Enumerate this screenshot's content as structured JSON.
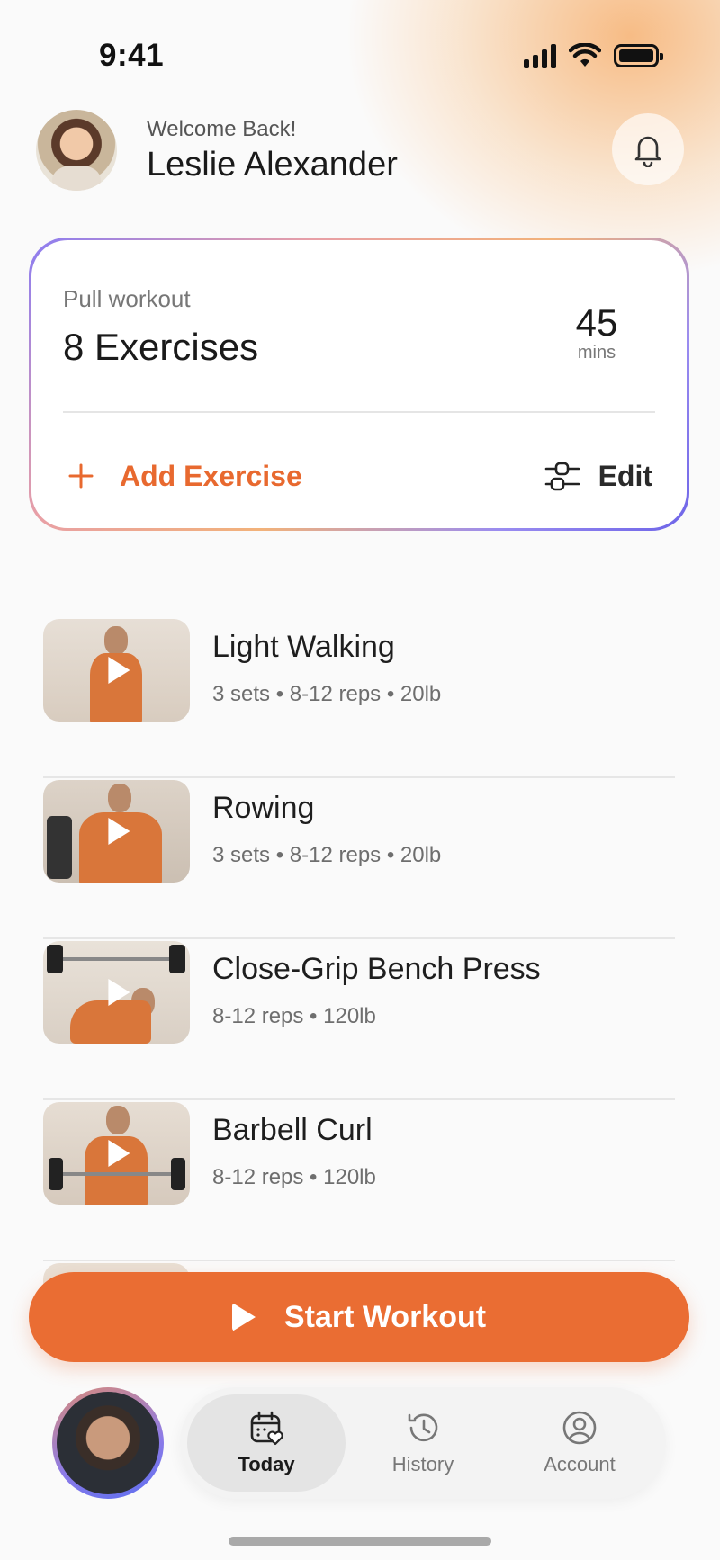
{
  "status_bar": {
    "time": "9:41"
  },
  "header": {
    "welcome": "Welcome Back!",
    "name": "Leslie Alexander"
  },
  "workout": {
    "subtitle": "Pull workout",
    "title": "8 Exercises",
    "duration_value": "45",
    "duration_unit": "mins",
    "add_label": "Add Exercise",
    "edit_label": "Edit"
  },
  "exercises": [
    {
      "name": "Light Walking",
      "meta": "3 sets • 8-12 reps • 20lb"
    },
    {
      "name": "Rowing",
      "meta": "3 sets • 8-12 reps • 20lb"
    },
    {
      "name": "Close-Grip Bench Press",
      "meta": "8-12 reps • 120lb"
    },
    {
      "name": "Barbell Curl",
      "meta": "8-12 reps • 120lb"
    }
  ],
  "start_button": {
    "label": "Start Workout"
  },
  "nav": {
    "tabs": [
      {
        "label": "Today",
        "icon": "calendar-heart-icon",
        "active": true
      },
      {
        "label": "History",
        "icon": "history-icon",
        "active": false
      },
      {
        "label": "Account",
        "icon": "user-circle-icon",
        "active": false
      }
    ]
  },
  "colors": {
    "accent": "#ea6d33",
    "text": "#1a1a1a",
    "muted": "#6e6e6e"
  }
}
